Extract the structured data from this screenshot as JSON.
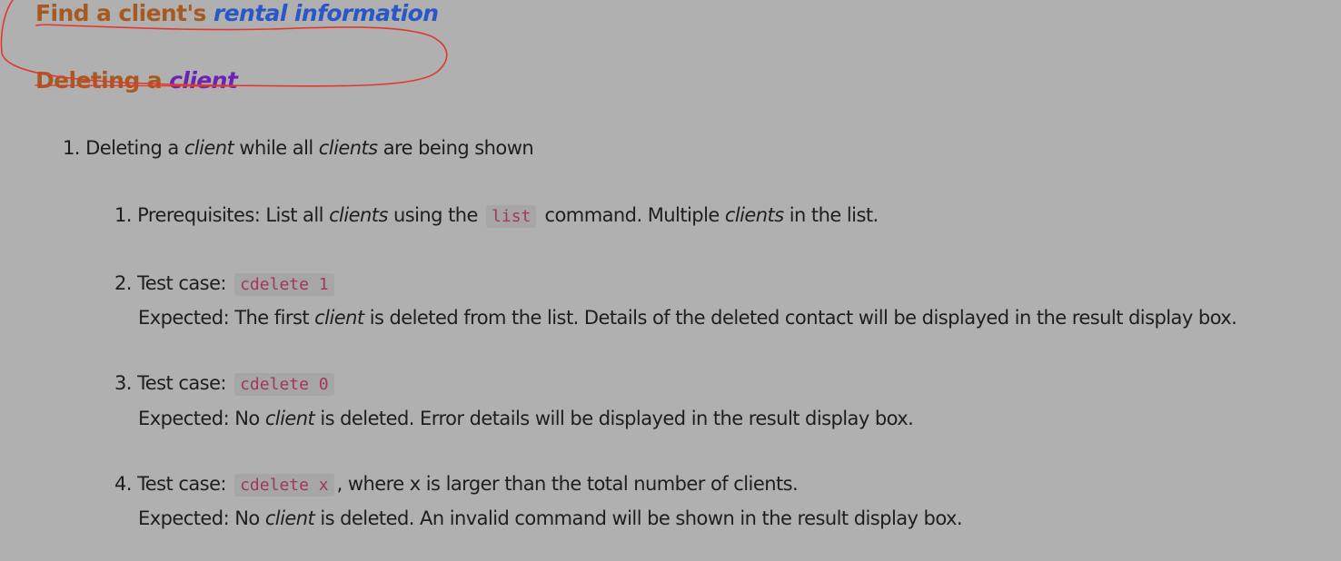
{
  "heading_find": {
    "prefix": "Find a client's ",
    "emph": "rental information"
  },
  "heading_delete": {
    "prefix": "Deleting a ",
    "emph": "client"
  },
  "item1": {
    "number": "1.",
    "t1": "Deleting a ",
    "e1": "client",
    "t2": " while all ",
    "e2": "clients",
    "t3": " are being shown"
  },
  "sub1": {
    "number": "1.",
    "t1": "Prerequisites: List all ",
    "e1": "clients",
    "t2": " using the ",
    "code": "list",
    "t3": " command. Multiple ",
    "e2": "clients",
    "t4": " in the list."
  },
  "sub2": {
    "number": "2.",
    "t1": "Test case: ",
    "code": "cdelete 1",
    "exp1": "Expected: The first ",
    "expE": "client",
    "exp2": " is deleted from the list. Details of the deleted contact will be displayed in the result display box."
  },
  "sub3": {
    "number": "3.",
    "t1": "Test case: ",
    "code": "cdelete 0",
    "exp1": "Expected: No ",
    "expE": "client",
    "exp2": " is deleted. Error details will be displayed in the result display box."
  },
  "sub4": {
    "number": "4.",
    "t1": "Test case: ",
    "code": "cdelete x",
    "t2": ", where x is larger than the total number of clients.",
    "exp1": "Expected: No ",
    "expE": "client",
    "exp2": " is deleted. An invalid command will be shown in the result display box."
  },
  "colors": {
    "background": "#b0b0b0",
    "heading": "#a55a24",
    "heading_link": "#2a56c6",
    "heading_emph": "#6a24b4",
    "code_text": "#a3365a",
    "annotation": "#e0392b"
  }
}
